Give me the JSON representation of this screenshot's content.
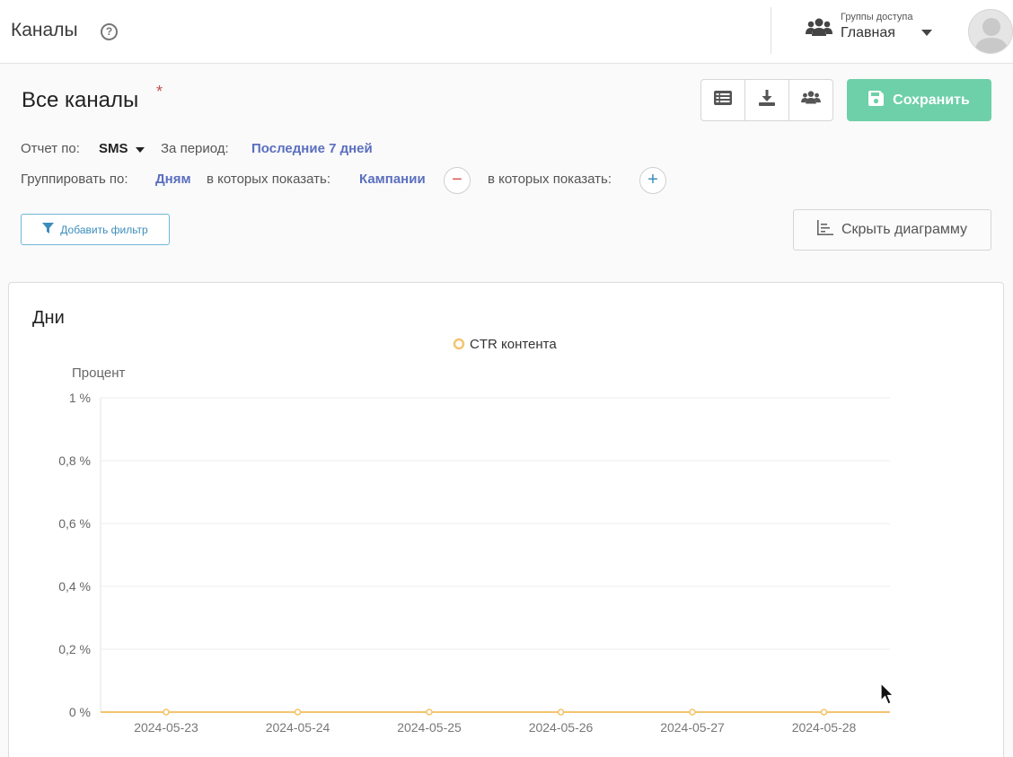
{
  "header": {
    "page_name": "Каналы",
    "help_glyph": "?",
    "access_group_caption": "Группы доступа",
    "access_group_value": "Главная"
  },
  "report": {
    "title": "Все каналы",
    "unsaved_marker": "*",
    "save_label": "Сохранить",
    "report_by_label": "Отчет по:",
    "report_by_value": "SMS",
    "period_label": "За период:",
    "period_value": "Последние 7 дней",
    "group_by_label": "Группировать по:",
    "group_by_value": "Дням",
    "show_in_label_1": "в которых показать:",
    "show_in_value_1": "Кампании",
    "show_in_label_2": "в которых показать:",
    "remove_glyph": "−",
    "add_glyph": "+",
    "add_filter_label": "Добавить фильтр",
    "hide_chart_label": "Скрыть диаграмму"
  },
  "colors": {
    "accent_link": "#5b6fbf",
    "save_green": "#6dd0a8",
    "series_orange": "#f5c46e",
    "remove_red": "#d9534f",
    "add_blue": "#3c8dbc"
  },
  "icons": [
    "help-icon",
    "users-icon",
    "chevron-down-icon",
    "avatar-icon",
    "list-icon",
    "download-icon",
    "share-users-icon",
    "save-icon",
    "filter-icon",
    "bar-chart-icon"
  ],
  "chart_data": {
    "type": "line",
    "title": "Дни",
    "ylabel": "Процент",
    "xlabel": "",
    "legend": "top-center",
    "grid": true,
    "ylim": [
      0,
      1
    ],
    "yticks": [
      "0 %",
      "0,2 %",
      "0,4 %",
      "0,6 %",
      "0,8 %",
      "1 %"
    ],
    "x": [
      "2024-05-23",
      "2024-05-24",
      "2024-05-25",
      "2024-05-26",
      "2024-05-27",
      "2024-05-28"
    ],
    "series": [
      {
        "name": "CTR контента",
        "color": "#f5c46e",
        "values": [
          0,
          0,
          0,
          0,
          0,
          0
        ]
      }
    ]
  }
}
